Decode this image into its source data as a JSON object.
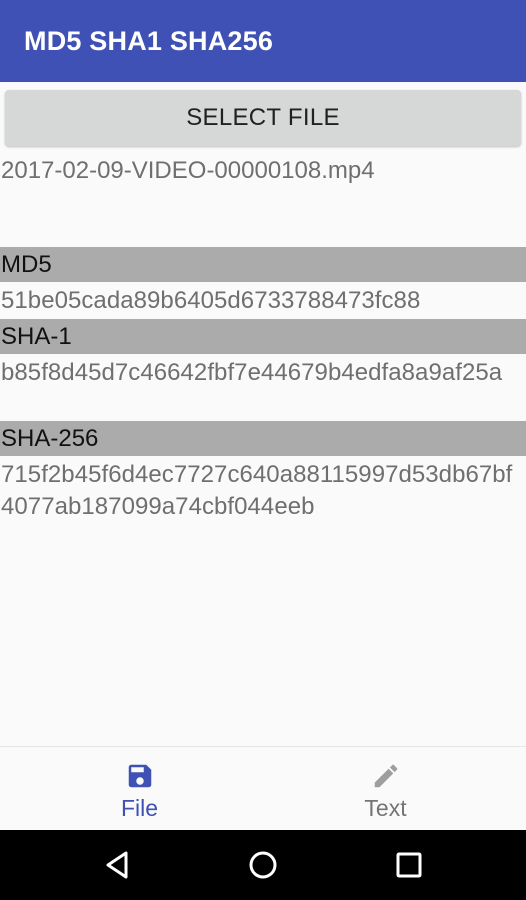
{
  "app_bar": {
    "title": "MD5 SHA1 SHA256",
    "color": "#3f51b5"
  },
  "select_button": {
    "label": "SELECT FILE"
  },
  "file": {
    "name": "2017-02-09-VIDEO-00000108.mp4"
  },
  "hashes": [
    {
      "label": "MD5",
      "value": "51be05cada89b6405d6733788473fc88"
    },
    {
      "label": "SHA-1",
      "value": "b85f8d45d7c46642fbf7e44679b4edfa8a9af25a"
    },
    {
      "label": "SHA-256",
      "value": "715f2b45f6d4ec7727c640a88115997d53db67bf4077ab187099a74cbf044eeb"
    }
  ],
  "bottom_nav": {
    "items": [
      {
        "label": "File",
        "icon": "save-icon",
        "active": true,
        "color": "#3f51b5"
      },
      {
        "label": "Text",
        "icon": "pencil-icon",
        "active": false,
        "color": "#757575"
      }
    ]
  },
  "system_nav": {
    "buttons": [
      "back-icon",
      "home-icon",
      "recents-icon"
    ]
  }
}
